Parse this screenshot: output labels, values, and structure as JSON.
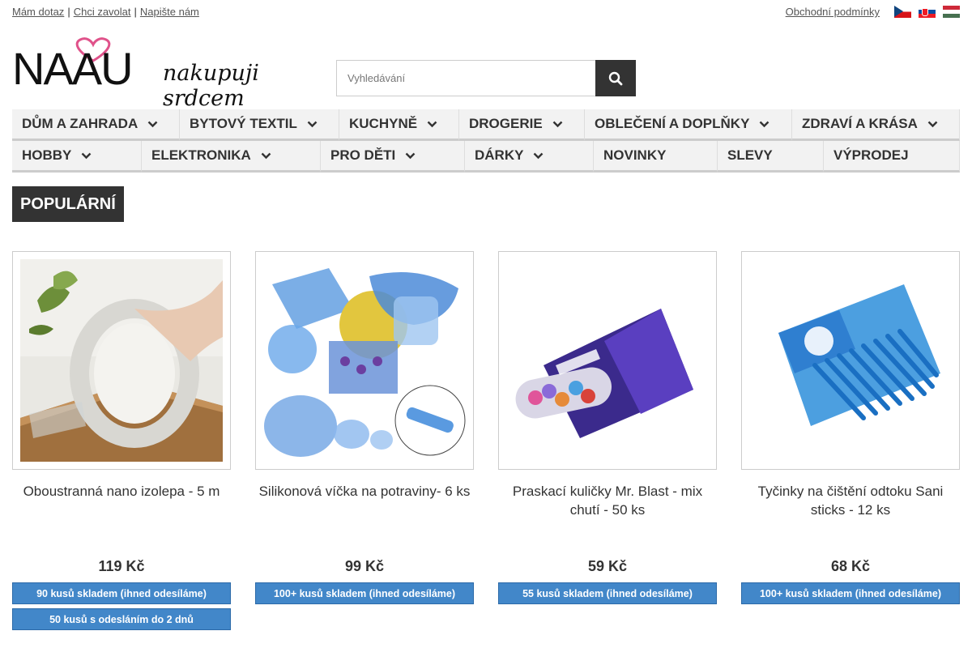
{
  "topbar": {
    "links": [
      "Mám dotaz",
      "Chci zavolat",
      "Napište nám"
    ],
    "terms": "Obchodní podmínky",
    "flags": [
      "cz-flag",
      "sk-flag",
      "hu-flag"
    ]
  },
  "logo": {
    "name": "NAAU",
    "tagline": "nakupuji srdcem"
  },
  "search": {
    "placeholder": "Vyhledávání",
    "icon": "search-icon"
  },
  "nav": {
    "row1": [
      {
        "label": "DŮM A ZAHRADA",
        "has_dropdown": true
      },
      {
        "label": "BYTOVÝ TEXTIL",
        "has_dropdown": true
      },
      {
        "label": "KUCHYNĚ",
        "has_dropdown": true
      },
      {
        "label": "DROGERIE",
        "has_dropdown": true
      },
      {
        "label": "OBLEČENÍ A DOPLŇKY",
        "has_dropdown": true
      },
      {
        "label": "ZDRAVÍ A KRÁSA",
        "has_dropdown": true
      }
    ],
    "row2": [
      {
        "label": "HOBBY",
        "has_dropdown": true
      },
      {
        "label": "ELEKTRONIKA",
        "has_dropdown": true
      },
      {
        "label": "PRO DĚTI",
        "has_dropdown": true
      },
      {
        "label": "DÁRKY",
        "has_dropdown": true
      },
      {
        "label": "NOVINKY",
        "has_dropdown": false
      },
      {
        "label": "SLEVY",
        "has_dropdown": false
      },
      {
        "label": "VÝPRODEJ",
        "has_dropdown": false
      }
    ]
  },
  "section": {
    "title": "POPULÁRNÍ"
  },
  "products": [
    {
      "name": "Oboustranná nano izolepa - 5 m",
      "price": "119 Kč",
      "stock": [
        "90 kusů skladem (ihned odesíláme)",
        "50 kusů s odesláním do 2 dnů"
      ]
    },
    {
      "name": "Silikonová víčka na potraviny- 6 ks",
      "price": "99 Kč",
      "stock": [
        "100+ kusů skladem (ihned odesíláme)"
      ]
    },
    {
      "name": "Praskací kuličky Mr. Blast - mix chutí - 50 ks",
      "price": "59 Kč",
      "stock": [
        "55 kusů skladem (ihned odesíláme)"
      ]
    },
    {
      "name": "Tyčinky na čištění odtoku Sani sticks - 12 ks",
      "price": "68 Kč",
      "stock": [
        "100+ kusů skladem (ihned odesíláme)"
      ]
    }
  ],
  "colors": {
    "accent": "#4287c9",
    "dark": "#333333",
    "heart": "#e0528a"
  }
}
